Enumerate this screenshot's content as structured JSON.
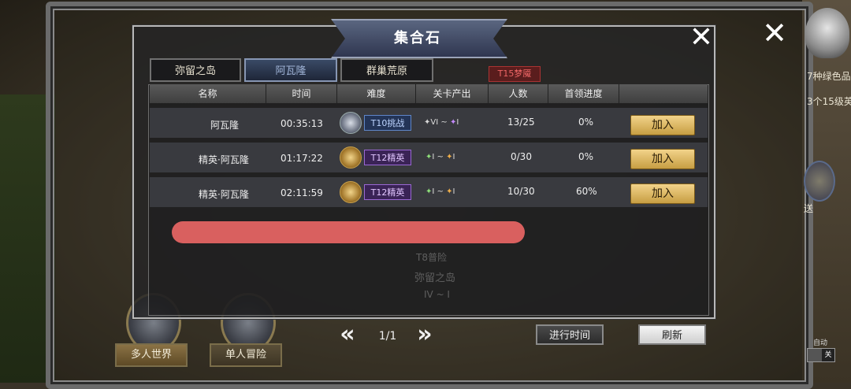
{
  "dialog": {
    "title": "集合石"
  },
  "tabs": [
    {
      "label": "弥留之岛",
      "active": false
    },
    {
      "label": "阿瓦隆",
      "active": true
    },
    {
      "label": "群巢荒原",
      "active": false
    }
  ],
  "tab_chip": "T15梦魇",
  "table": {
    "headers": [
      "名称",
      "时间",
      "难度",
      "关卡产出",
      "人数",
      "首领进度"
    ],
    "rows": [
      {
        "name": "阿瓦隆",
        "time": "00:35:13",
        "difficulty": "T10挑战",
        "difficulty_color": "blue",
        "drop_from": "VI",
        "drop_to": "I",
        "players": "13/25",
        "progress": "0%",
        "join": "加入"
      },
      {
        "name": "精英·阿瓦隆",
        "time": "01:17:22",
        "difficulty": "T12精英",
        "difficulty_color": "purple",
        "drop_from": "I",
        "drop_to": "I",
        "players": "0/30",
        "progress": "0%",
        "join": "加入"
      },
      {
        "name": "精英·阿瓦隆",
        "time": "02:11:59",
        "difficulty": "T12精英",
        "difficulty_color": "purple",
        "drop_from": "I",
        "drop_to": "I",
        "players": "10/30",
        "progress": "60%",
        "join": "加入"
      }
    ],
    "drop_separator": "~"
  },
  "pager": {
    "text": "1/1"
  },
  "buttons": {
    "progress_time": "进行时间",
    "refresh": "刷新"
  },
  "modes": [
    {
      "label": "多人世界",
      "active": true
    },
    {
      "label": "单人冒险",
      "active": false
    }
  ],
  "background": {
    "ghost_tag": "T8普险",
    "ghost_location": "弥留之岛",
    "ghost_drop": "IV ~ I"
  },
  "sidebar": {
    "line1": "7种绿色品",
    "line2": "3个15级英",
    "teleport": "送",
    "auto_label": "自动",
    "auto_state": "关"
  },
  "icons": {
    "close": "close-icon",
    "prev": "chevron-double-left-icon",
    "next": "chevron-double-right-icon"
  },
  "colors": {
    "join_button": "#e2bd68",
    "redaction": "#d9605f",
    "active_tab": "#3a4a66"
  }
}
